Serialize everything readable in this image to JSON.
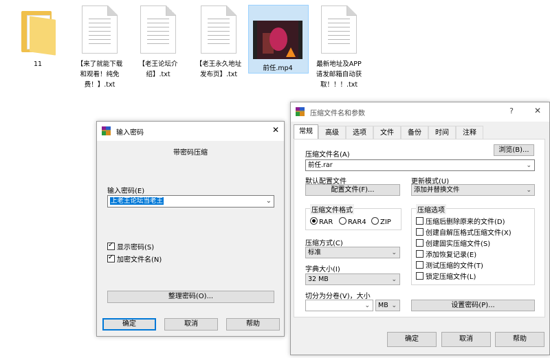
{
  "desktop": {
    "files": [
      {
        "name": "11",
        "type": "folder"
      },
      {
        "name": "【来了就能下载和观看！纯免费！】.txt",
        "type": "txt",
        "lines": [
          "【来了就能下载",
          "和观看！纯免",
          "费！】.txt"
        ]
      },
      {
        "name": "【老王论坛介绍】.txt",
        "type": "txt",
        "lines": [
          "【老王论坛介",
          "绍】.txt"
        ]
      },
      {
        "name": "【老王永久地址发布页】.txt",
        "type": "txt",
        "lines": [
          "【老王永久地址",
          "发布页】.txt"
        ]
      },
      {
        "name": "前任.mp4",
        "type": "video",
        "lines": [
          "前任.mp4"
        ]
      },
      {
        "name": "最新地址及APP请发邮箱自动获取！！！.txt",
        "type": "txt",
        "lines": [
          "最新地址及APP",
          "请发邮箱自动获",
          "取！！！.txt"
        ]
      }
    ]
  },
  "password_dialog": {
    "title": "输入密码",
    "close": "✕",
    "subtitle": "带密码压缩",
    "enter_label": "输入密码(E)",
    "password_value": "上老王论坛当老王",
    "show_password": "显示密码(S)",
    "encrypt_names": "加密文件名(N)",
    "organize": "整理密码(O)...",
    "ok": "确定",
    "cancel": "取消",
    "help": "帮助"
  },
  "archive_dialog": {
    "title": "压缩文件名和参数",
    "help_q": "?",
    "close": "✕",
    "tabs": [
      "常规",
      "高级",
      "选项",
      "文件",
      "备份",
      "时间",
      "注释"
    ],
    "archive_name_label": "压缩文件名(A)",
    "browse": "浏览(B)...",
    "archive_name_value": "前任.rar",
    "default_profile_label": "默认配置文件",
    "profile_button": "配置文件(F)...",
    "update_mode_label": "更新模式(U)",
    "update_mode_value": "添加并替换文件",
    "format_group": "压缩文件格式",
    "formats": [
      "RAR",
      "RAR4",
      "ZIP"
    ],
    "format_selected": "RAR",
    "options_group": "压缩选项",
    "options": [
      "压缩后删除原来的文件(D)",
      "创建自解压格式压缩文件(X)",
      "创建固实压缩文件(S)",
      "添加恢复记录(E)",
      "测试压缩的文件(T)",
      "锁定压缩文件(L)"
    ],
    "method_label": "压缩方式(C)",
    "method_value": "标准",
    "dict_label": "字典大小(I)",
    "dict_value": "32 MB",
    "split_label": "切分为分卷(V)，大小",
    "split_unit": "MB",
    "set_password": "设置密码(P)...",
    "ok": "确定",
    "cancel": "取消",
    "help": "帮助"
  },
  "icons": {
    "dropdown": "chevron-down-icon",
    "winrar": "winrar-icon"
  }
}
